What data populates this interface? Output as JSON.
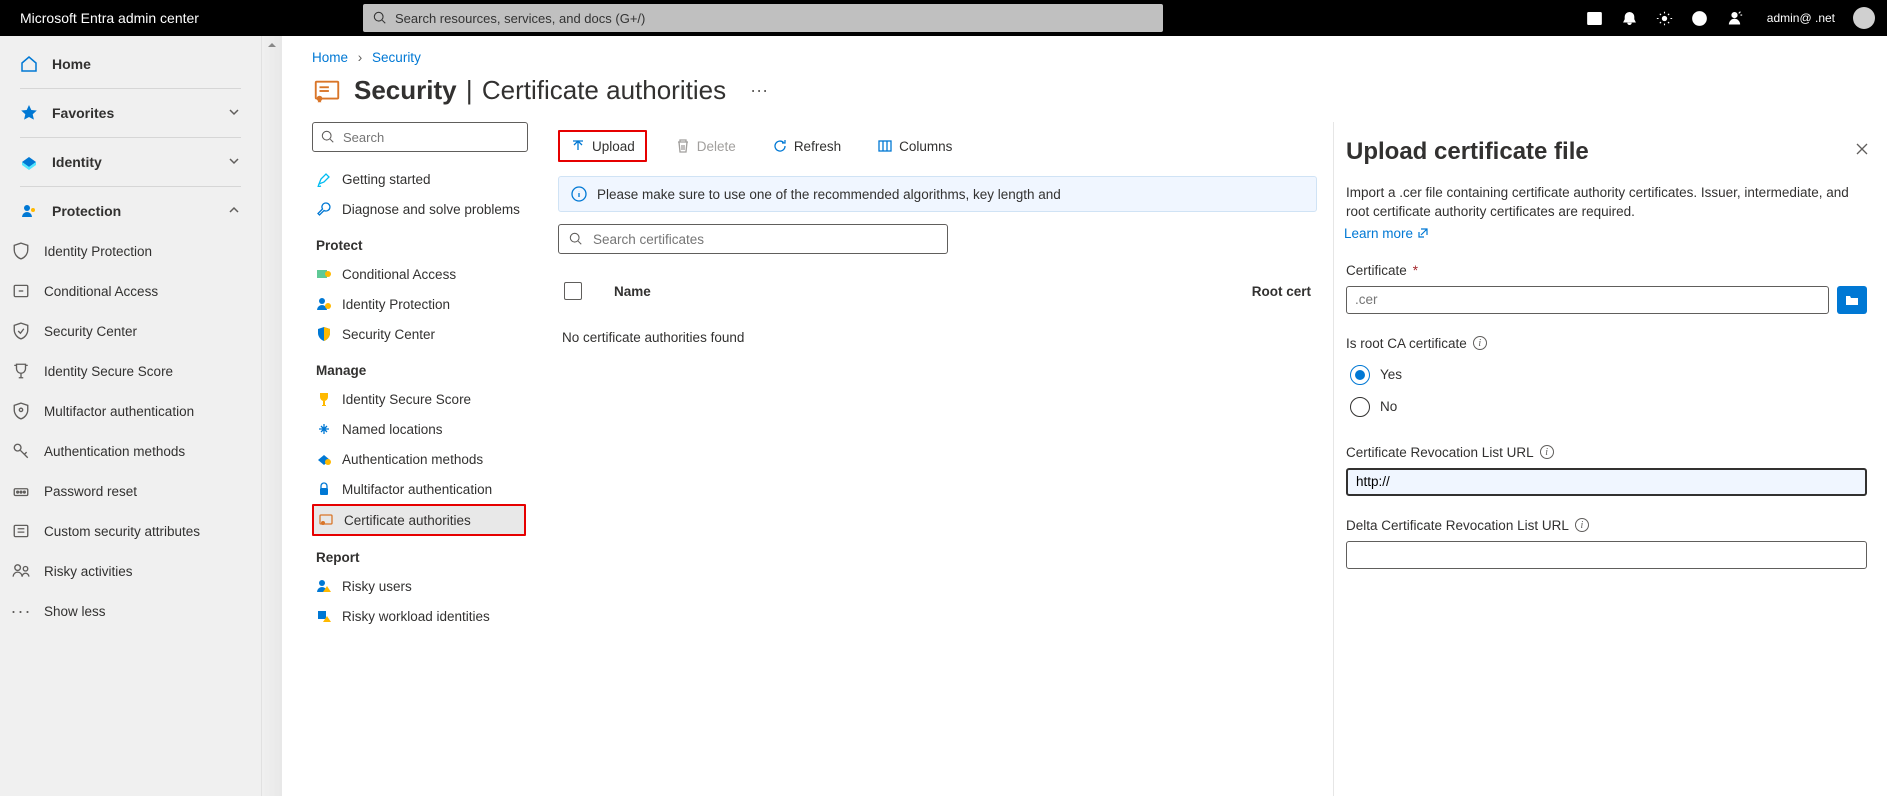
{
  "header": {
    "title": "Microsoft Entra admin center",
    "search_placeholder": "Search resources, services, and docs (G+/)",
    "user": "admin@ .net"
  },
  "sidebar": {
    "home": "Home",
    "favorites": "Favorites",
    "identity": "Identity",
    "protection": "Protection",
    "items": [
      "Identity Protection",
      "Conditional Access",
      "Security Center",
      "Identity Secure Score",
      "Multifactor authentication",
      "Authentication methods",
      "Password reset",
      "Custom security attributes",
      "Risky activities",
      "Show less"
    ]
  },
  "breadcrumb": {
    "home": "Home",
    "security": "Security"
  },
  "page": {
    "title": "Security",
    "subtitle": "Certificate authorities"
  },
  "subnav": {
    "search_placeholder": "Search",
    "items_top": [
      "Getting started",
      "Diagnose and solve problems"
    ],
    "protect_heading": "Protect",
    "protect_items": [
      "Conditional Access",
      "Identity Protection",
      "Security Center"
    ],
    "manage_heading": "Manage",
    "manage_items": [
      "Identity Secure Score",
      "Named locations",
      "Authentication methods",
      "Multifactor authentication",
      "Certificate authorities"
    ],
    "report_heading": "Report",
    "report_items": [
      "Risky users",
      "Risky workload identities"
    ]
  },
  "toolbar": {
    "upload": "Upload",
    "delete": "Delete",
    "refresh": "Refresh",
    "columns": "Columns"
  },
  "notice": "Please make sure to use one of the recommended algorithms, key length and",
  "search_certs_placeholder": "Search certificates",
  "table": {
    "name_col": "Name",
    "root_col": "Root cert",
    "empty": "No certificate authorities found"
  },
  "panel": {
    "title": "Upload certificate file",
    "desc": "Import a .cer file containing certificate authority certificates. Issuer, intermediate, and root certificate authority certificates are required.",
    "learn_more": "Learn more",
    "cert_label": "Certificate",
    "cert_placeholder": ".cer",
    "root_label": "Is root CA certificate",
    "yes": "Yes",
    "no": "No",
    "crl_label": "Certificate Revocation List URL",
    "crl_value": "http://",
    "delta_label": "Delta Certificate Revocation List URL"
  }
}
